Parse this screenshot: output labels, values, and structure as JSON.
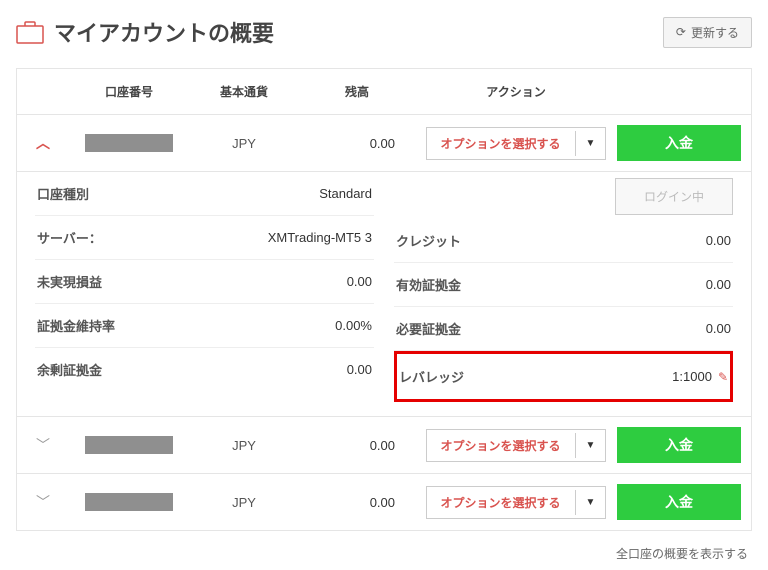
{
  "header": {
    "title": "マイアカウントの概要",
    "refresh": "更新する"
  },
  "thead": {
    "account": "口座番号",
    "currency": "基本通貨",
    "balance": "残高",
    "action": "アクション"
  },
  "row_labels": {
    "select_option": "オプションを選択する",
    "deposit": "入金"
  },
  "rows": [
    {
      "currency": "JPY",
      "balance": "0.00",
      "expanded": true
    },
    {
      "currency": "JPY",
      "balance": "0.00",
      "expanded": false
    },
    {
      "currency": "JPY",
      "balance": "0.00",
      "expanded": false
    }
  ],
  "details_left": {
    "account_type": {
      "label": "口座種別",
      "value": "Standard"
    },
    "server": {
      "label": "サーバー：",
      "value": "XMTrading-MT5 3"
    },
    "unrealized": {
      "label": "未実現損益",
      "value": "0.00"
    },
    "margin_level": {
      "label": "証拠金維持率",
      "value": "0.00%"
    },
    "free_margin": {
      "label": "余剰証拠金",
      "value": "0.00"
    }
  },
  "details_right": {
    "login_btn": "ログイン中",
    "credit": {
      "label": "クレジット",
      "value": "0.00"
    },
    "equity": {
      "label": "有効証拠金",
      "value": "0.00"
    },
    "margin": {
      "label": "必要証拠金",
      "value": "0.00"
    },
    "leverage": {
      "label": "レバレッジ",
      "value": "1:1000"
    }
  },
  "footer": {
    "show_all": "全口座の概要を表示する"
  }
}
